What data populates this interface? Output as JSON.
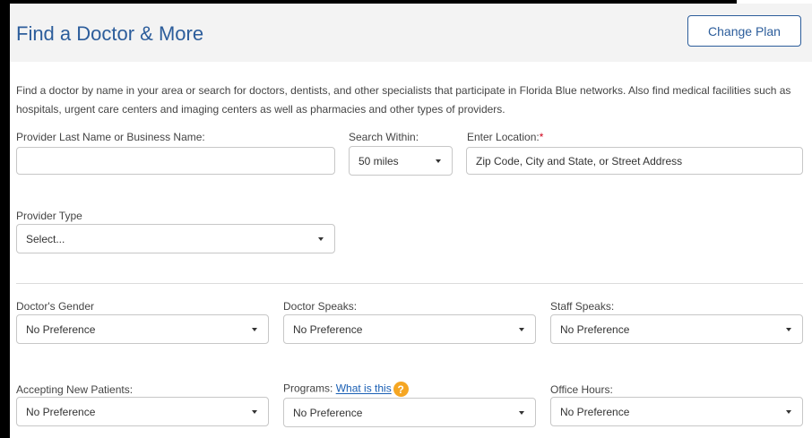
{
  "header": {
    "title": "Find a Doctor & More",
    "change_plan_label": "Change Plan"
  },
  "intro_text": "Find a doctor by name in your area or search for doctors, dentists, and other specialists that participate in Florida Blue networks. Also find medical facilities such as hospitals, urgent care centers and imaging centers as well as pharmacies and other types of providers.",
  "search": {
    "provider_name_label": "Provider Last Name or Business Name:",
    "provider_name_value": "",
    "search_within_label": "Search Within:",
    "search_within_value": "50 miles",
    "location_label": "Enter Location:",
    "location_required_marker": "*",
    "location_placeholder": "Zip Code, City and State, or Street Address"
  },
  "provider_type": {
    "label": "Provider Type",
    "value": "Select..."
  },
  "filters": {
    "gender": {
      "label": "Doctor's Gender",
      "value": "No Preference"
    },
    "doctor_speaks": {
      "label": "Doctor Speaks:",
      "value": "No Preference"
    },
    "staff_speaks": {
      "label": "Staff Speaks:",
      "value": "No Preference"
    },
    "accepting": {
      "label": "Accepting New Patients:",
      "value": "No Preference"
    },
    "programs": {
      "label": "Programs:",
      "help_link": "What is this",
      "help_icon": "?",
      "value": "No Preference"
    },
    "office_hours": {
      "label": "Office Hours:",
      "value": "No Preference"
    }
  },
  "colors": {
    "accent": "#2c5d9b",
    "help_icon": "#f5a623",
    "required": "#d0021b"
  }
}
